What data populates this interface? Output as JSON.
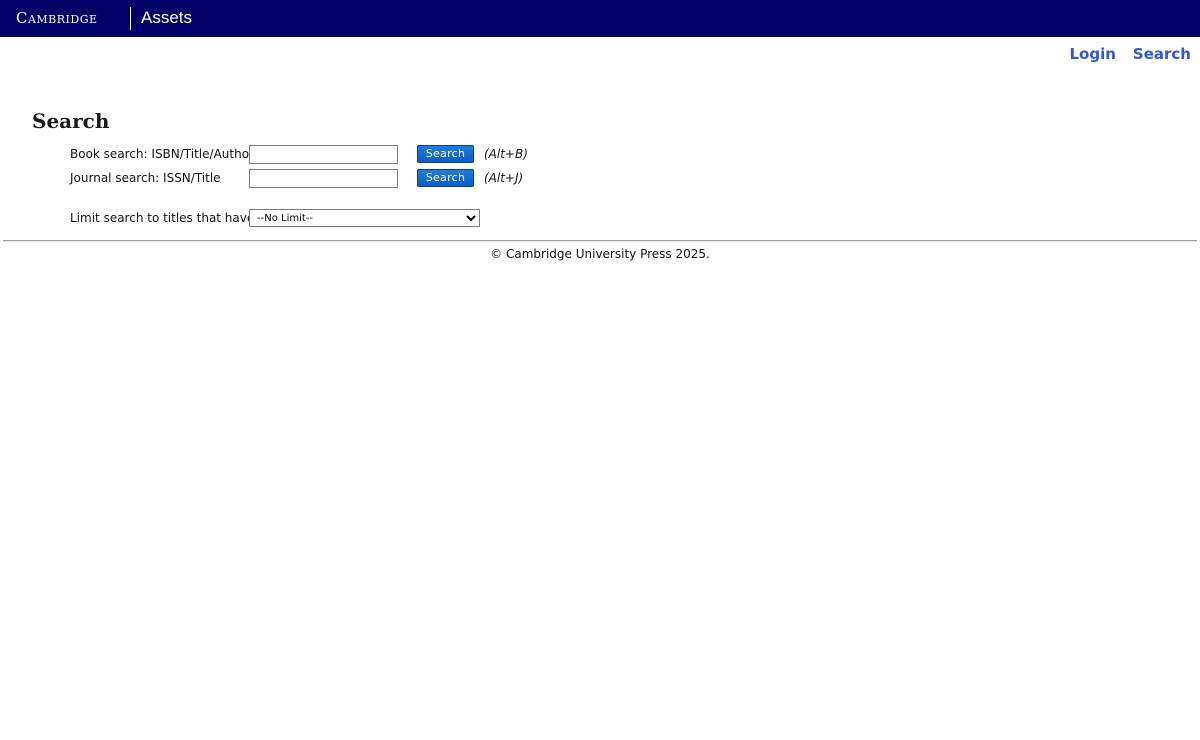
{
  "header": {
    "logo_text": "Cambridge",
    "product_name": "Assets",
    "background_color": "#000066"
  },
  "nav": {
    "login_label": "Login",
    "search_label": "Search",
    "link_color": "#3355dd"
  },
  "page": {
    "title": "Search"
  },
  "book_search": {
    "label": "Book search: ISBN/Title/Author",
    "value": "",
    "button_label": "Search",
    "shortcut": "(Alt+B)"
  },
  "journal_search": {
    "label": "Journal search: ISSN/Title",
    "value": "",
    "button_label": "Search",
    "shortcut": "(Alt+J)"
  },
  "limit": {
    "label": "Limit search to titles that have:",
    "selected_option": "--No Limit--",
    "icon": "chevron-down-icon"
  },
  "footer": {
    "copyright": "© Cambridge University Press 2025."
  },
  "accent": {
    "button_color": "#0b5ec4"
  }
}
